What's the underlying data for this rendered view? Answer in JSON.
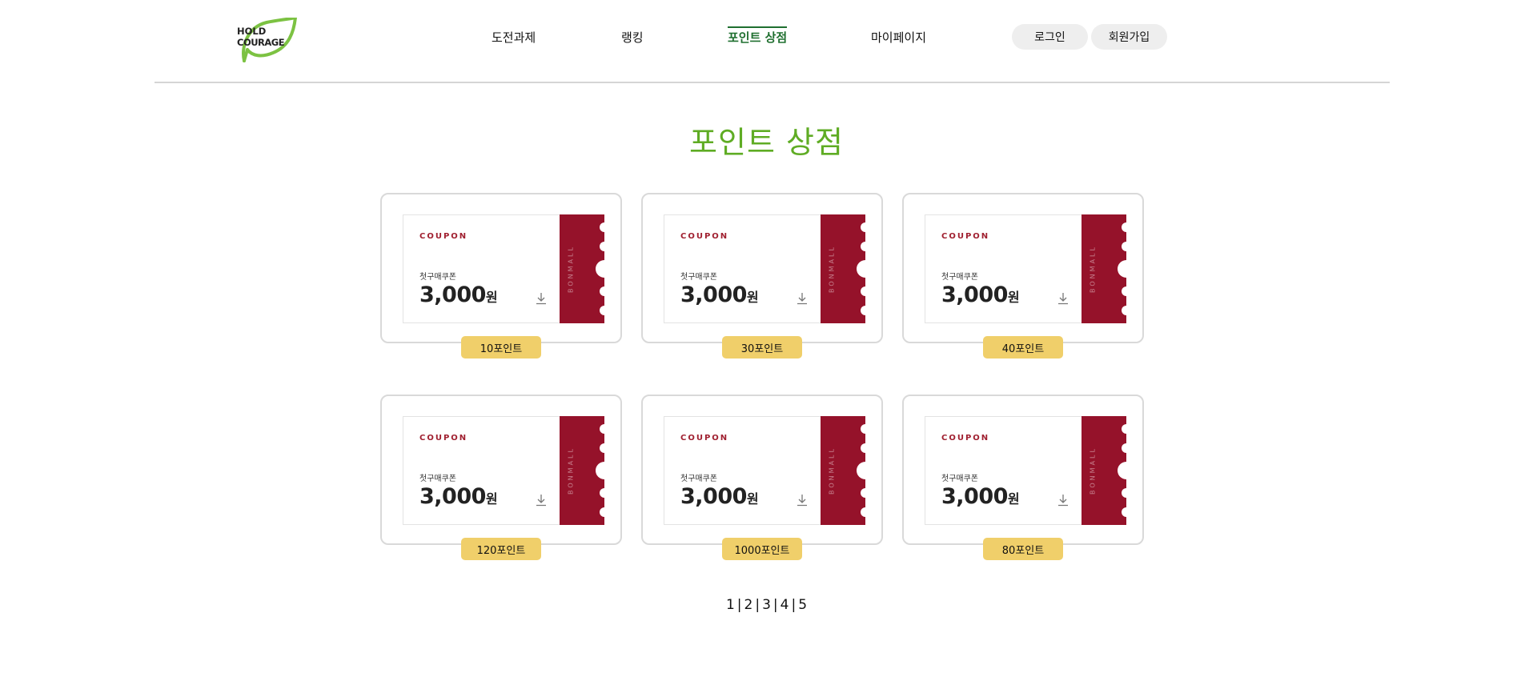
{
  "header": {
    "logo_text_line1": "HOLD",
    "logo_text_line2": "COURAGE",
    "nav": [
      {
        "label": "도전과제",
        "active": false
      },
      {
        "label": "랭킹",
        "active": false
      },
      {
        "label": "포인트 상점",
        "active": true
      },
      {
        "label": "마이페이지",
        "active": false
      }
    ],
    "login_label": "로그인",
    "signup_label": "회원가입"
  },
  "main": {
    "title": "포인트 상점",
    "items": [
      {
        "coupon_label": "COUPON",
        "description": "첫구매쿠폰",
        "amount": "3,000",
        "unit": "원",
        "brand": "BONMALL",
        "price": "10포인트"
      },
      {
        "coupon_label": "COUPON",
        "description": "첫구매쿠폰",
        "amount": "3,000",
        "unit": "원",
        "brand": "BONMALL",
        "price": "30포인트"
      },
      {
        "coupon_label": "COUPON",
        "description": "첫구매쿠폰",
        "amount": "3,000",
        "unit": "원",
        "brand": "BONMALL",
        "price": "40포인트"
      },
      {
        "coupon_label": "COUPON",
        "description": "첫구매쿠폰",
        "amount": "3,000",
        "unit": "원",
        "brand": "BONMALL",
        "price": "120포인트"
      },
      {
        "coupon_label": "COUPON",
        "description": "첫구매쿠폰",
        "amount": "3,000",
        "unit": "원",
        "brand": "BONMALL",
        "price": "1000포인트"
      },
      {
        "coupon_label": "COUPON",
        "description": "첫구매쿠폰",
        "amount": "3,000",
        "unit": "원",
        "brand": "BONMALL",
        "price": "80포인트"
      }
    ],
    "pagination": {
      "pages": [
        "1",
        "2",
        "3",
        "4",
        "5"
      ],
      "separator": "|"
    }
  },
  "colors": {
    "title_green": "#5fac24",
    "active_nav_green": "#1f6f2f",
    "coupon_red": "#95122a",
    "price_button_yellow": "#f0cf6a",
    "auth_button_gray": "#eeeeee"
  },
  "icons": {
    "logo": "leaf-logo-icon",
    "coupon_action": "download-icon"
  }
}
